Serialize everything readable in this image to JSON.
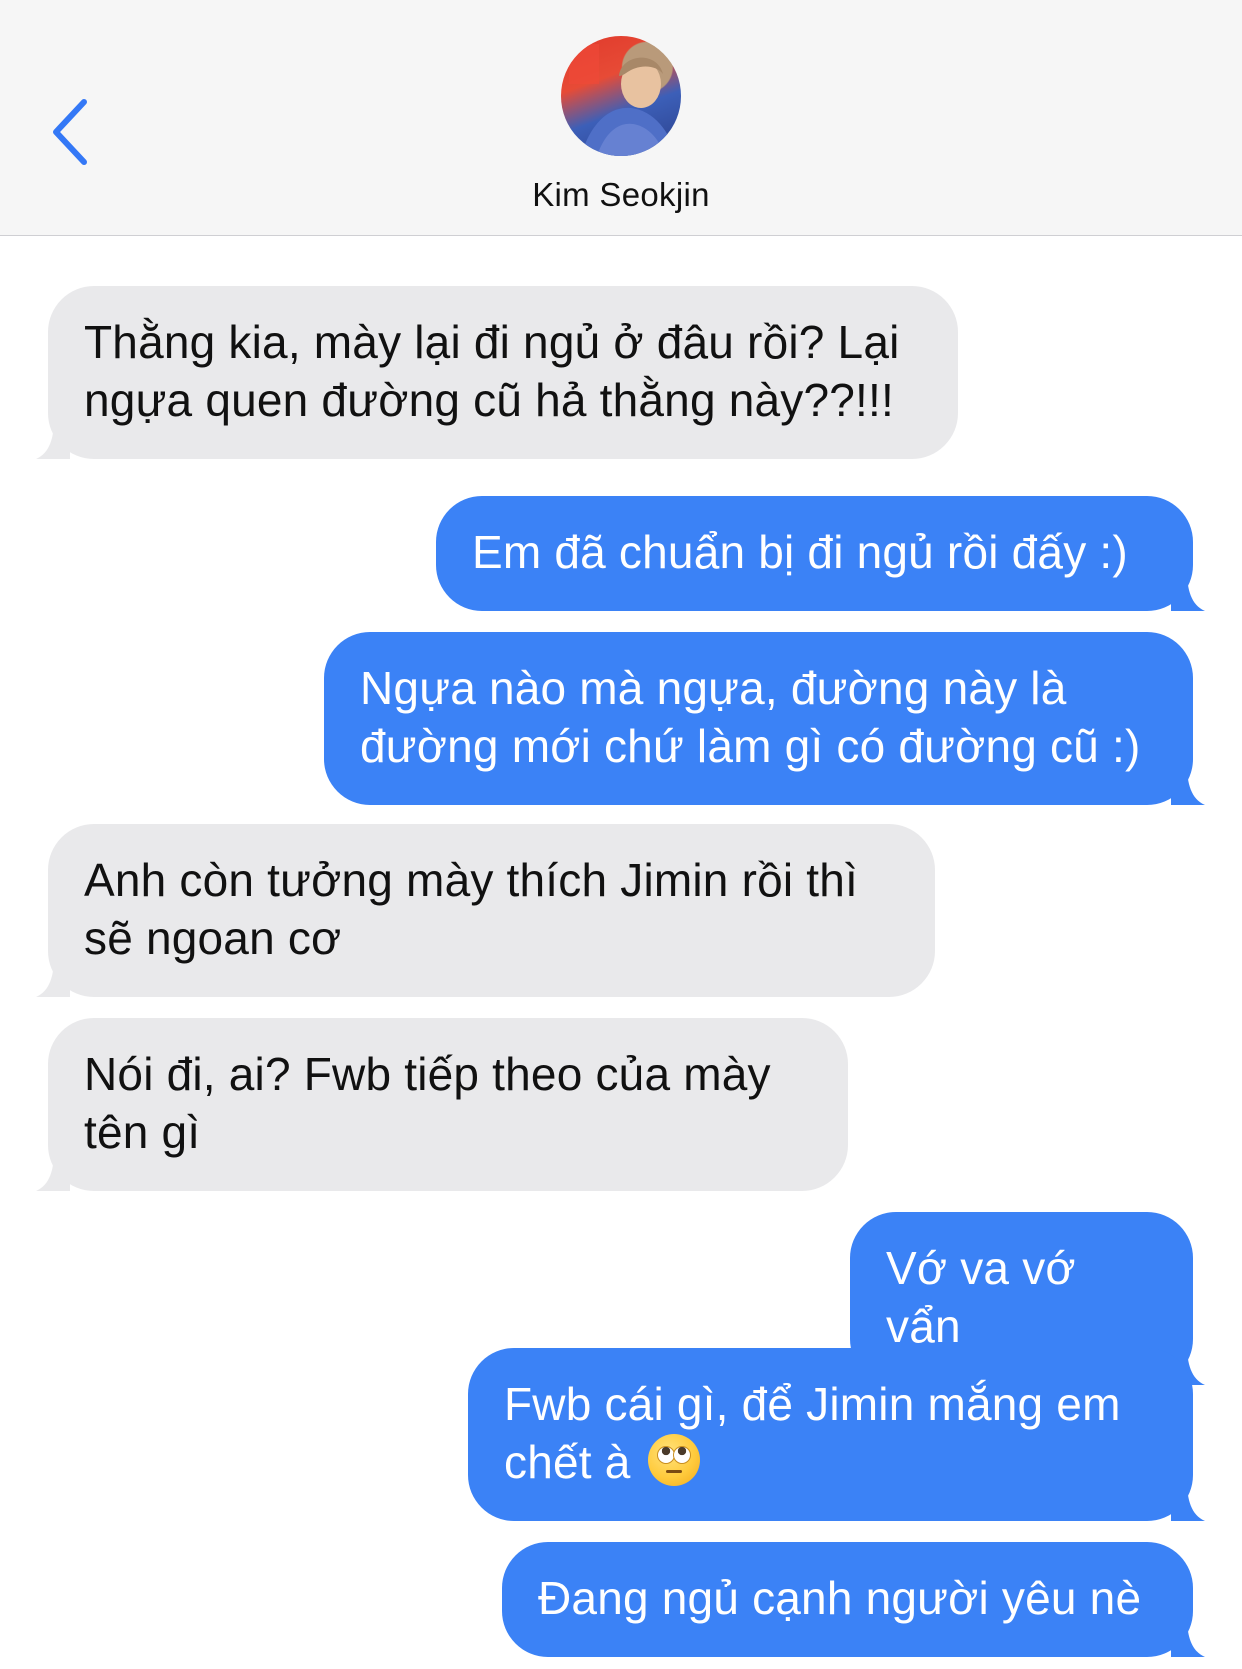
{
  "header": {
    "contact_name": "Kim Seokjin"
  },
  "messages": [
    {
      "side": "received",
      "lines": [
        "Thằng kia, mày lại đi ngủ ở đâu rồi? Lại",
        "ngựa quen đường cũ hả thằng này??!!!"
      ]
    },
    {
      "side": "sent",
      "lines": [
        "Em đã chuẩn bị đi ngủ rồi đấy :)"
      ]
    },
    {
      "side": "sent",
      "lines": [
        "Ngựa nào mà ngựa, đường này là",
        "đường mới chứ làm gì có đường cũ :)"
      ]
    },
    {
      "side": "received",
      "lines": [
        "Anh còn tưởng mày thích Jimin rồi thì",
        "sẽ ngoan cơ"
      ]
    },
    {
      "side": "received",
      "lines": [
        "Nói đi, ai? Fwb tiếp theo của mày",
        "tên gì"
      ]
    },
    {
      "side": "sent",
      "lines": [
        "Vớ va vớ vẩn"
      ]
    },
    {
      "side": "sent",
      "lines": [
        "Fwb cái gì, để Jimin mắng em",
        "chết à"
      ],
      "emoji": "face-with-rolling-eyes"
    },
    {
      "side": "sent",
      "lines": [
        "Đang ngủ cạnh người yêu nè"
      ]
    }
  ],
  "colors": {
    "sent_bubble": "#3b82f6",
    "received_bubble": "#e9e9eb",
    "accent": "#3478f6",
    "header_bg": "#f6f6f6"
  },
  "icons": {
    "back": "chevron-left-icon",
    "avatar": "contact-avatar"
  }
}
